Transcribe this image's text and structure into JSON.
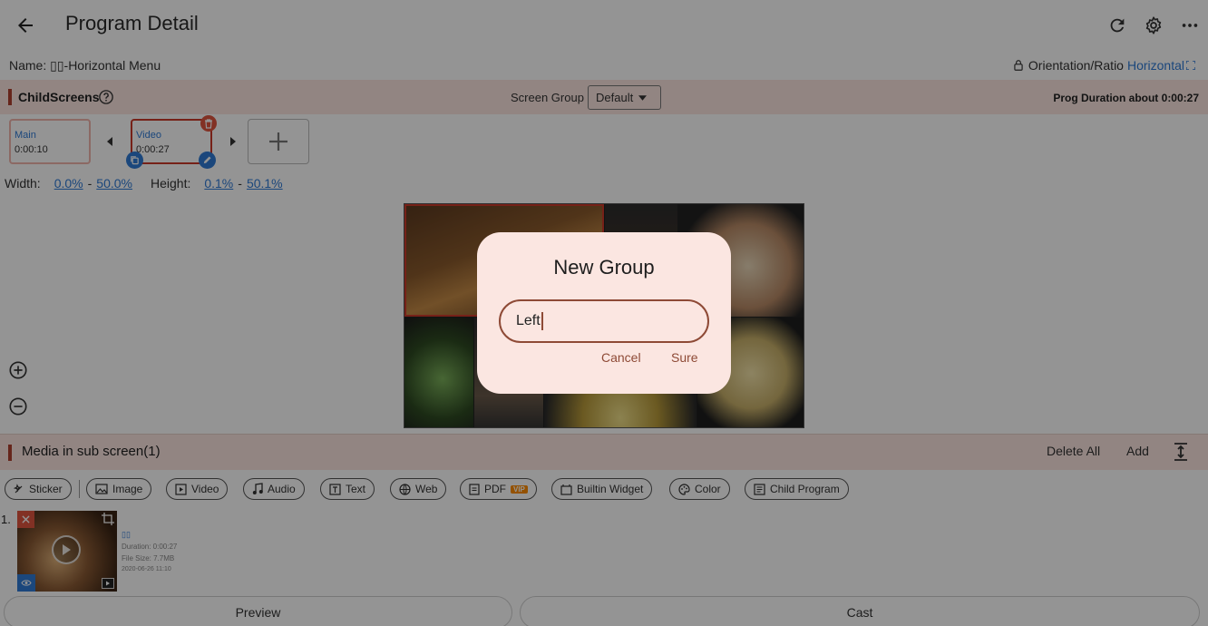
{
  "header": {
    "title": "Program Detail"
  },
  "program": {
    "name_label": "Name: ▯▯-Horizontal Menu",
    "orientation_label": "Orientation/Ratio",
    "orientation_value": "Horizontal"
  },
  "childscreens": {
    "title": "ChildScreens",
    "group_label": "Screen Group",
    "group_value": "Default",
    "duration": "Prog Duration about 0:00:27",
    "screens": [
      {
        "name": "Main",
        "time": "0:00:10"
      },
      {
        "name": "Video",
        "time": "0:00:27"
      }
    ],
    "width_label": "Width:",
    "width_from": "0.0%",
    "width_to": "50.0%",
    "height_label": "Height:",
    "height_from": "0.1%",
    "height_to": "50.1%",
    "dash": "-"
  },
  "media": {
    "title": "Media in sub screen(1)",
    "delete_all": "Delete All",
    "add": "Add",
    "chips": [
      "Sticker",
      "Image",
      "Video",
      "Audio",
      "Text",
      "Web",
      "PDF",
      "Builtin Widget",
      "Color",
      "Child Program"
    ],
    "vip_badge": "VIP",
    "items": [
      {
        "index": "1.",
        "name": "▯▯",
        "duration": "Duration: 0:00:27",
        "file_size": "File Size: 7.7MB",
        "date": "2020-06-26 11:10"
      }
    ]
  },
  "footer": {
    "preview": "Preview",
    "cast": "Cast"
  },
  "dialog": {
    "title": "New Group",
    "input_value": "Left",
    "cancel": "Cancel",
    "sure": "Sure"
  },
  "colors": {
    "accent": "#b04030",
    "link": "#2f7ad6",
    "dialog_bg": "#fbe6e1",
    "dialog_accent": "#8e4a36"
  }
}
